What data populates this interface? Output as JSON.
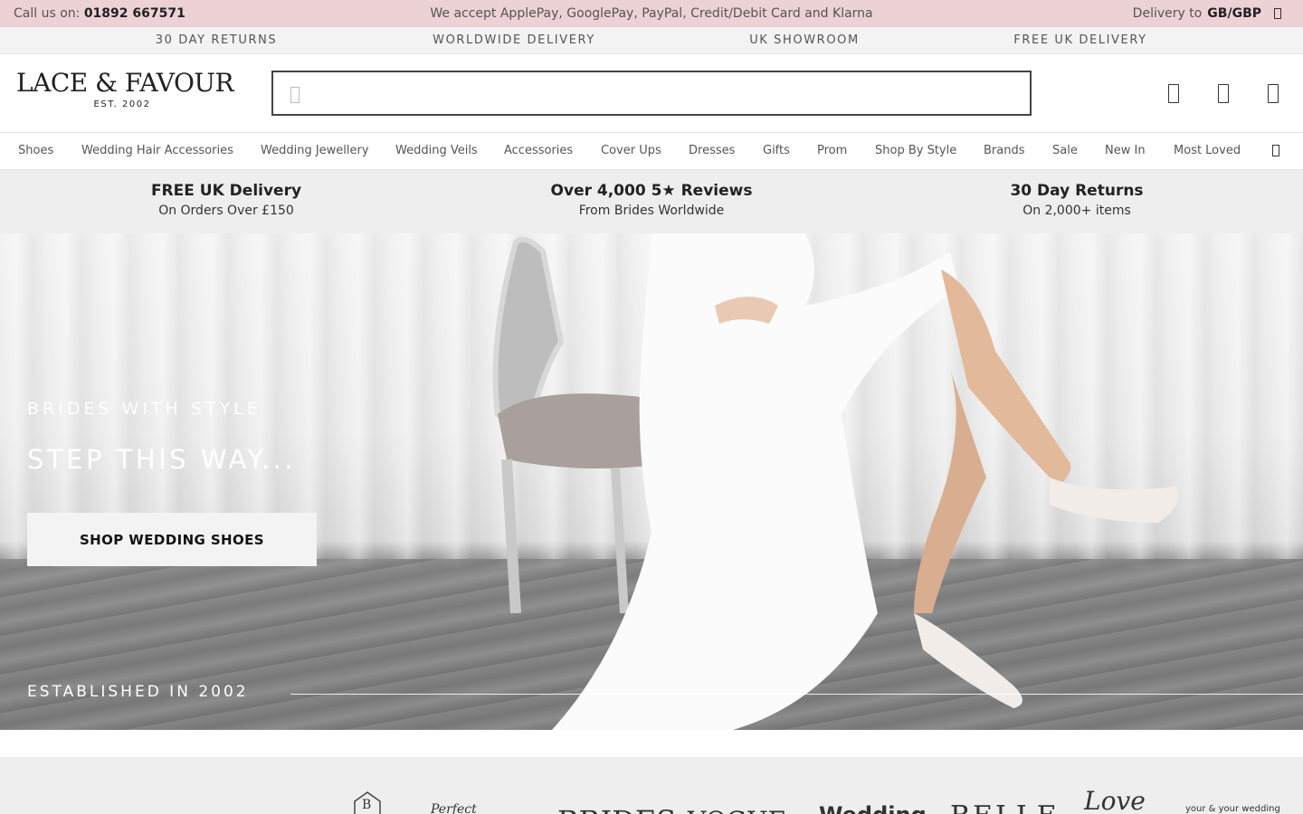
{
  "topbar": {
    "call_prefix": "Call us on:",
    "phone": "01892 667571",
    "payments": "We accept ApplePay, GooglePay, PayPal, Credit/Debit Card and Klarna",
    "delivery_prefix": "Delivery to",
    "delivery_region": "GB/GBP"
  },
  "benefits": [
    "30 DAY RETURNS",
    "WORLDWIDE DELIVERY",
    "UK SHOWROOM",
    "FREE UK DELIVERY"
  ],
  "logo": {
    "name": "LACE & FAVOUR",
    "est": "EST. 2002"
  },
  "search": {
    "placeholder": ""
  },
  "header_icons": [
    "user-icon",
    "wishlist-icon",
    "basket-icon"
  ],
  "nav": {
    "items": [
      "Shoes",
      "Wedding Hair Accessories",
      "Wedding Jewellery",
      "Wedding Veils",
      "Accessories",
      "Cover Ups",
      "Dresses",
      "Gifts",
      "Prom",
      "Shop By Style",
      "Brands",
      "Sale",
      "New In",
      "Most Loved"
    ]
  },
  "usp": [
    {
      "title": "FREE UK Delivery",
      "sub": "On Orders Over £150"
    },
    {
      "title": "Over 4,000 5★ Reviews",
      "sub": "From Brides Worldwide"
    },
    {
      "title": "30 Day Returns",
      "sub": "On 2,000+ items"
    }
  ],
  "hero": {
    "kicker": "BRIDES WITH STYLE",
    "title": "STEP THIS WAY...",
    "cta": "SHOP WEDDING SHOES",
    "established": "ESTABLISHED IN 2002"
  },
  "press_logos": [
    "B",
    "Perfect",
    "BRIDES",
    "VOGUE",
    "Wedding",
    "BELLE",
    "Love",
    "your & your wedding"
  ],
  "colors": {
    "topbar_bg": "#ecd1d5",
    "strip_bg": "#eeeeee",
    "text_dark": "#222222"
  }
}
